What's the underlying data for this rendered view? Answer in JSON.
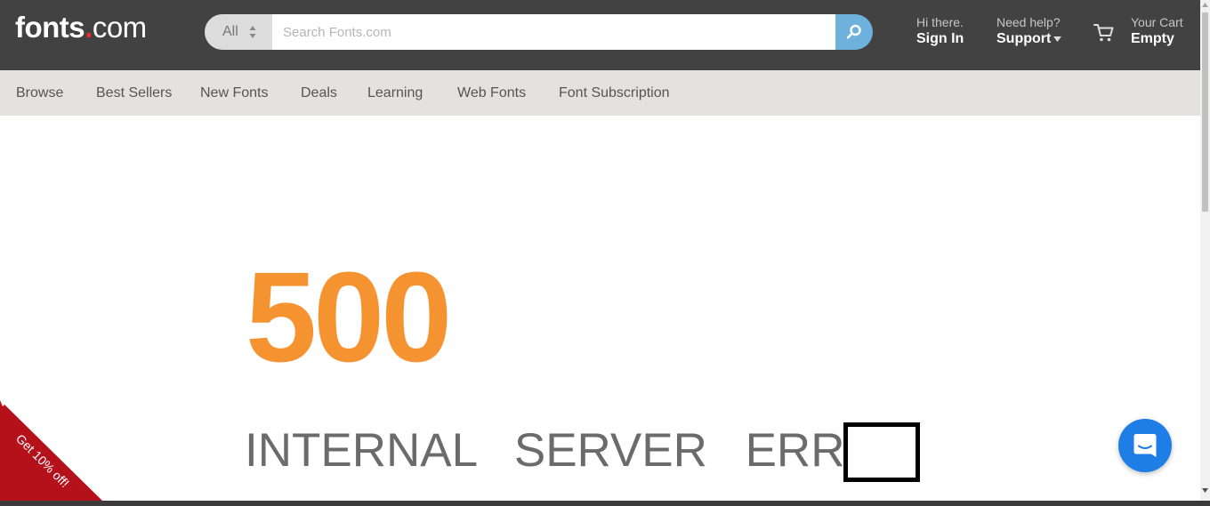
{
  "header": {
    "logo": {
      "brand": "fonts",
      "dot": ".",
      "tld": "com"
    },
    "search": {
      "category": "All",
      "placeholder": "Search Fonts.com",
      "value": "",
      "button_icon": "search-icon"
    },
    "account": {
      "greeting": "Hi there.",
      "label": "Sign In"
    },
    "help": {
      "prompt": "Need help?",
      "label": "Support"
    },
    "cart": {
      "prompt": "Your Cart",
      "status": "Empty",
      "icon": "cart-icon"
    }
  },
  "nav": {
    "items": [
      {
        "label": "Browse"
      },
      {
        "label": "Best Sellers"
      },
      {
        "label": "New Fonts"
      },
      {
        "label": "Deals"
      },
      {
        "label": "Learning"
      },
      {
        "label": "Web Fonts"
      },
      {
        "label": "Font Subscription"
      }
    ]
  },
  "main": {
    "error_code": "500",
    "error_message": "INTERNAL SERVER ERR"
  },
  "promo": {
    "label": "Get 10% off!"
  },
  "chat": {
    "icon": "chat-bubble-icon"
  },
  "colors": {
    "header_bg": "#424242",
    "nav_bg": "#e3e2de",
    "accent_orange": "#f59331",
    "search_button": "#6eb1dc",
    "promo_red": "#b5111b",
    "chat_blue": "#1f7de6",
    "logo_dot": "#e0312b"
  }
}
